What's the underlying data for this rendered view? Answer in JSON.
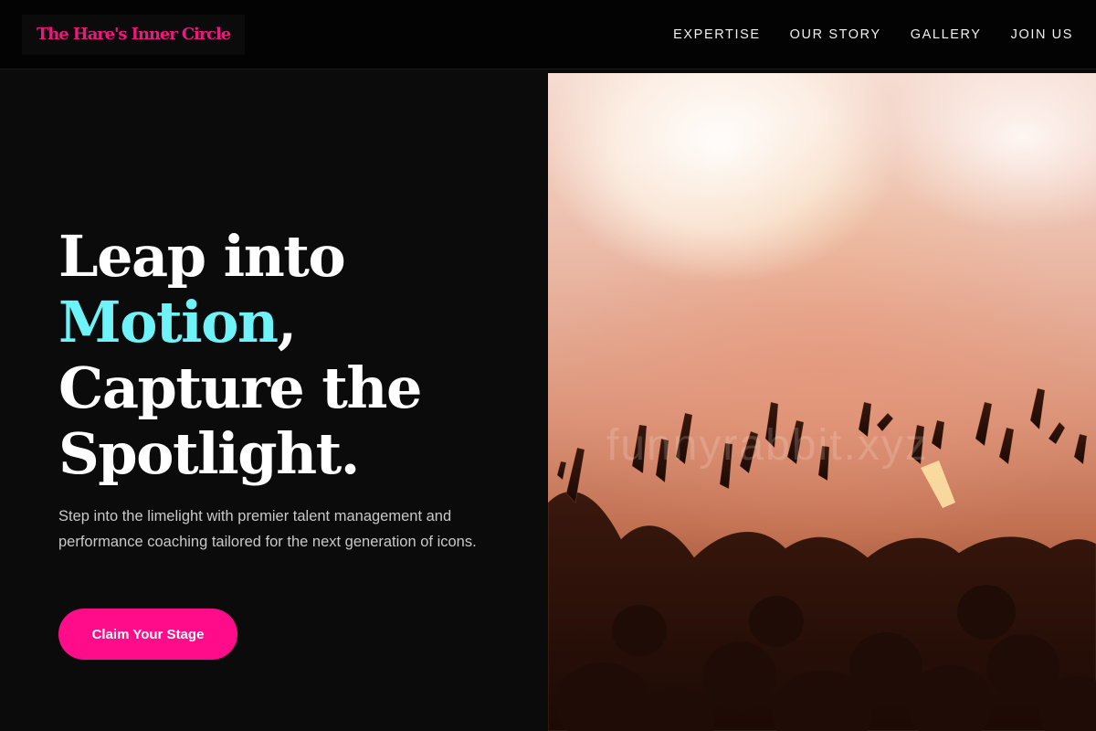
{
  "header": {
    "logo": "The Hare's Inner Circle",
    "nav": [
      {
        "label": "EXPERTISE"
      },
      {
        "label": "OUR STORY"
      },
      {
        "label": "GALLERY"
      },
      {
        "label": "JOIN US"
      }
    ]
  },
  "hero": {
    "headline": {
      "line1": "Leap into",
      "accent": "Motion",
      "accent_suffix": ",",
      "line3": "Capture the",
      "line4": "Spotlight."
    },
    "description": "Step into the limelight with premier talent management and performance coaching tailored for the next generation of icons.",
    "cta_label": "Claim Your Stage"
  },
  "image": {
    "watermark": "funnyrabbit.xyz"
  },
  "colors": {
    "brand": "#e8197f",
    "accent": "#6ef4f8",
    "cta": "#ff0c8a",
    "background": "#0b0b0c"
  }
}
